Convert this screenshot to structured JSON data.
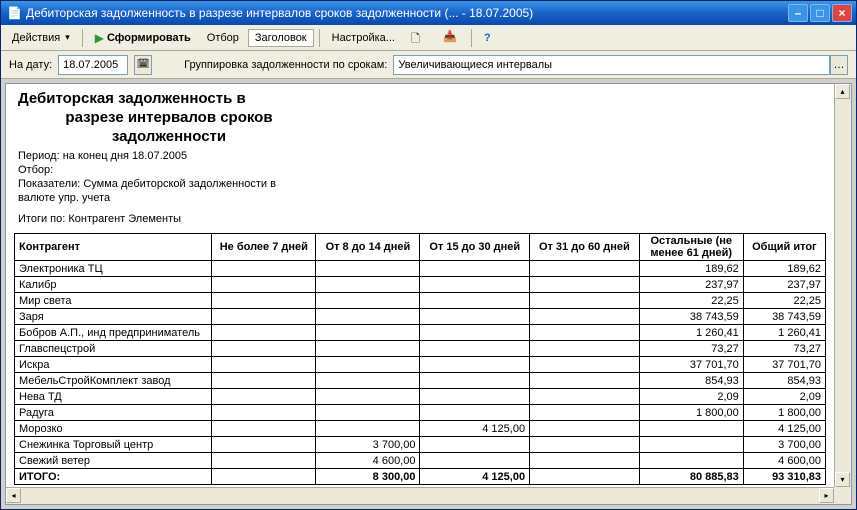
{
  "window": {
    "title": "Дебиторская задолженность в разрезе интервалов сроков задолженности (... - 18.07.2005)"
  },
  "toolbar": {
    "actions": "Действия",
    "form": "Сформировать",
    "filter": "Отбор",
    "header": "Заголовок",
    "settings": "Настройка..."
  },
  "params": {
    "date_label": "На дату:",
    "date_value": "18.07.2005",
    "group_label": "Группировка задолженности по срокам:",
    "group_value": "Увеличивающиеся интервалы"
  },
  "report": {
    "title_l1": "Дебиторская задолженность в",
    "title_l2": "разрезе интервалов сроков",
    "title_l3": "задолженности",
    "period": "Период: на конец дня 18.07.2005",
    "filter": "Отбор:",
    "indicators_l1": "Показатели:  Сумма дебиторской задолженности в",
    "indicators_l2": "валюте упр. учета",
    "totals_by": "Итоги по:  Контрагент Элементы",
    "columns": {
      "c0": "Контрагент",
      "c1": "Не более 7 дней",
      "c2": "От 8 до 14 дней",
      "c3": "От 15 до 30 дней",
      "c4": "От 31 до 60 дней",
      "c5": "Остальные (не менее 61 дней)",
      "c6": "Общий итог"
    },
    "rows": [
      {
        "name": "Электроника ТЦ",
        "c1": "",
        "c2": "",
        "c3": "",
        "c4": "",
        "c5": "189,62",
        "c6": "189,62"
      },
      {
        "name": "Калибр",
        "c1": "",
        "c2": "",
        "c3": "",
        "c4": "",
        "c5": "237,97",
        "c6": "237,97"
      },
      {
        "name": "Мир света",
        "c1": "",
        "c2": "",
        "c3": "",
        "c4": "",
        "c5": "22,25",
        "c6": "22,25"
      },
      {
        "name": "Заря",
        "c1": "",
        "c2": "",
        "c3": "",
        "c4": "",
        "c5": "38 743,59",
        "c6": "38 743,59"
      },
      {
        "name": "Бобров А.П., инд предприниматель",
        "c1": "",
        "c2": "",
        "c3": "",
        "c4": "",
        "c5": "1 260,41",
        "c6": "1 260,41"
      },
      {
        "name": "Главспецстрой",
        "c1": "",
        "c2": "",
        "c3": "",
        "c4": "",
        "c5": "73,27",
        "c6": "73,27"
      },
      {
        "name": "Искра",
        "c1": "",
        "c2": "",
        "c3": "",
        "c4": "",
        "c5": "37 701,70",
        "c6": "37 701,70"
      },
      {
        "name": "МебельСтройКомплект завод",
        "c1": "",
        "c2": "",
        "c3": "",
        "c4": "",
        "c5": "854,93",
        "c6": "854,93"
      },
      {
        "name": "Нева ТД",
        "c1": "",
        "c2": "",
        "c3": "",
        "c4": "",
        "c5": "2,09",
        "c6": "2,09"
      },
      {
        "name": "Радуга",
        "c1": "",
        "c2": "",
        "c3": "",
        "c4": "",
        "c5": "1 800,00",
        "c6": "1 800,00"
      },
      {
        "name": "Морозко",
        "c1": "",
        "c2": "",
        "c3": "4 125,00",
        "c4": "",
        "c5": "",
        "c6": "4 125,00"
      },
      {
        "name": "Снежинка Торговый центр",
        "c1": "",
        "c2": "3 700,00",
        "c3": "",
        "c4": "",
        "c5": "",
        "c6": "3 700,00"
      },
      {
        "name": "Свежий ветер",
        "c1": "",
        "c2": "4 600,00",
        "c3": "",
        "c4": "",
        "c5": "",
        "c6": "4 600,00"
      }
    ],
    "total": {
      "name": "ИТОГО:",
      "c1": "",
      "c2": "8 300,00",
      "c3": "4 125,00",
      "c4": "",
      "c5": "80 885,83",
      "c6": "93 310,83"
    }
  }
}
